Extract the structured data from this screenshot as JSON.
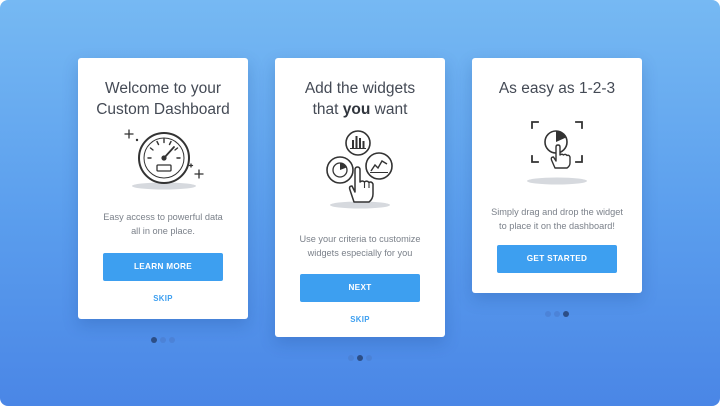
{
  "cards": [
    {
      "title_line1": "Welcome to your",
      "title_line2": "Custom Dashboard",
      "description_line1": "Easy access to powerful data",
      "description_line2": "all in one place.",
      "button_label": "LEARN MORE",
      "skip_label": "SKIP",
      "illustration": "speedometer-icon",
      "active_dot": 1
    },
    {
      "title_line1": "Add the widgets",
      "title_line2_pre": "that ",
      "title_line2_bold": "you",
      "title_line2_post": " want",
      "description_line1": "Use your criteria to customize",
      "description_line2": "widgets especially for you",
      "button_label": "NEXT",
      "skip_label": "SKIP",
      "illustration": "widgets-hand-icon",
      "active_dot": 2
    },
    {
      "title_line1": "As easy as 1-2-3",
      "description_line1": "Simply drag and drop the widget",
      "description_line2": "to place it on the dashboard!",
      "button_label": "GET STARTED",
      "illustration": "drag-drop-icon",
      "active_dot": 3
    }
  ],
  "colors": {
    "accent": "#3d9ff0",
    "background_top": "#76b9f3",
    "background_bottom": "#4a86e6",
    "dot_active": "#2c4e86",
    "dot_inactive": "#4b7fd1"
  }
}
